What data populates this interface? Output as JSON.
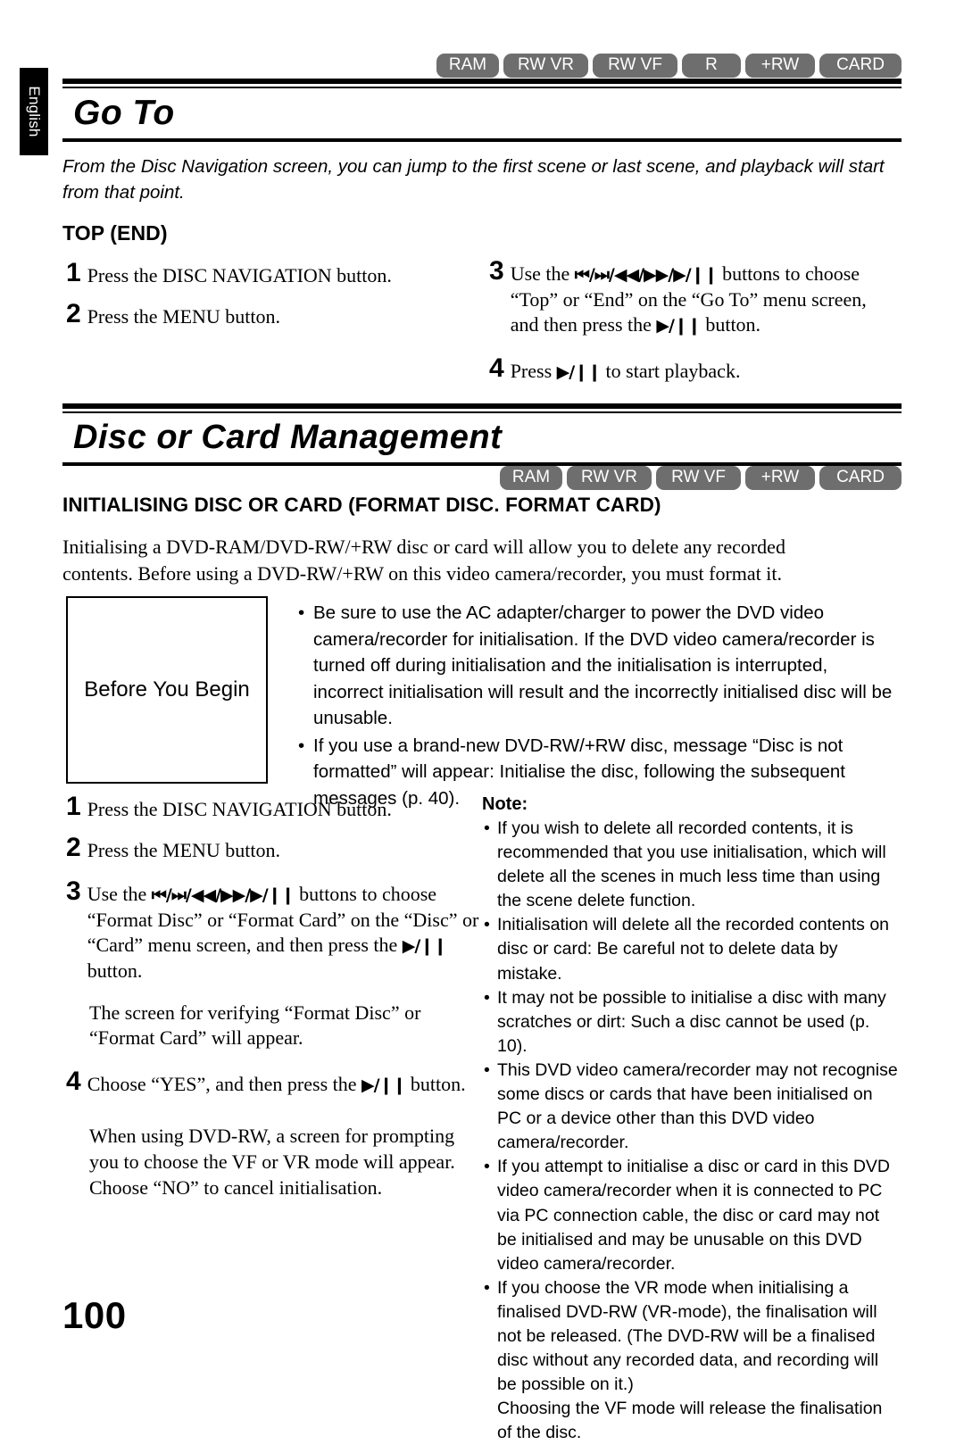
{
  "language_tab": "English",
  "page_number": "100",
  "badges": {
    "row1": [
      "RAM",
      "RW VR",
      "RW VF",
      "R",
      "+RW",
      "CARD"
    ],
    "row2": [
      "RAM",
      "RW VR",
      "RW VF",
      "+RW",
      "CARD"
    ]
  },
  "colors": {
    "badge_background": "#6e6e6e",
    "badge_text": "#ffffff",
    "rule": "#000000",
    "tab_background": "#000000"
  },
  "sections": {
    "goto": {
      "title": "Go To",
      "intro": "From the Disc Navigation screen, you can jump to the first scene or last scene, and playback will start from that point.",
      "subheading": "TOP (END)",
      "steps_left": [
        {
          "num": "1",
          "text": "Press the DISC NAVIGATION button."
        },
        {
          "num": "2",
          "text": "Press the MENU button."
        }
      ],
      "steps_right": [
        {
          "num": "3",
          "text_a": "Use the ",
          "glyphs": "⏮/⏭/◀◀/▶▶/▶/❙❙",
          "text_b": " buttons to choose “Top” or “End” on the “Go To” menu screen, and then press the ",
          "glyph_end": "▶/❙❙",
          "text_c": " button."
        },
        {
          "num": "4",
          "text_a": "Press ",
          "glyphs": "▶/❙❙",
          "text_b": " to start playback."
        }
      ]
    },
    "disc_card_management": {
      "title": "Disc or Card Management",
      "subheading": "INITIALISING DISC OR CARD (FORMAT DISC. FORMAT CARD)",
      "paragraph": "Initialising a DVD-RAM/DVD-RW/+RW disc or card will allow you to delete any recorded contents. Before using a DVD-RW/+RW on this video camera/recorder, you must format it.",
      "before_you_begin": {
        "label": "Before You Begin",
        "bullets": [
          "Be sure to use the AC adapter/charger to power the DVD video camera/recorder for initialisation. If the DVD video camera/recorder is turned off during initialisation and the initialisation is interrupted, incorrect initialisation will result and the incorrectly initialised disc will be unusable.",
          "If you use a brand-new DVD-RW/+RW disc, message “Disc is not formatted” will appear: Initialise the disc, following the subsequent messages (p. 40)."
        ]
      },
      "steps": [
        {
          "num": "1",
          "text": "Press the DISC NAVIGATION button."
        },
        {
          "num": "2",
          "text": "Press the MENU button."
        },
        {
          "num": "3",
          "text_a": "Use the ",
          "glyphs": "⏮/⏭/◀◀/▶▶/▶/❙❙",
          "text_b": " buttons to choose “Format Disc” or “Format Card” on the “Disc” or “Card” menu screen, and then press the ",
          "glyph_end": "▶/❙❙",
          "text_c": " button."
        }
      ],
      "note_after_step3": "The screen for verifying “Format Disc” or “Format Card” will appear.",
      "step4": {
        "num": "4",
        "text_a": "Choose “YES”, and then press the ",
        "glyphs": "▶/❙❙",
        "text_b": " button."
      },
      "closing_paragraph": "When using DVD-RW, a screen for prompting you to choose the VF or VR mode will appear. Choose “NO” to cancel initialisation.",
      "note": {
        "title": "Note:",
        "bullets": [
          "If you wish to delete all recorded contents, it is recommended that you use initialisation, which will delete all the scenes in much less time than using the scene delete function.",
          "Initialisation will delete all the recorded contents on disc or card: Be careful not to delete data by mistake.",
          "It may not be possible to initialise a disc with many scratches or dirt: Such a disc cannot be used (p. 10).",
          "This DVD video camera/recorder may not recognise some discs or cards that have been initialised on PC or a device other than this DVD video camera/recorder.",
          "If you attempt to initialise a disc or card in this DVD video camera/recorder when it is connected to PC via PC connection cable, the disc or card may not be initialised and may be unusable on this DVD video camera/recorder.",
          "If you choose the VR mode when initialising a finalised DVD-RW (VR-mode), the finalisation will not be released. (The DVD-RW will be a finalised disc without any recorded data, and recording will be possible on it.)"
        ],
        "bullet6_continuation": "Choosing the VF mode will release the finalisation of the disc."
      }
    }
  }
}
